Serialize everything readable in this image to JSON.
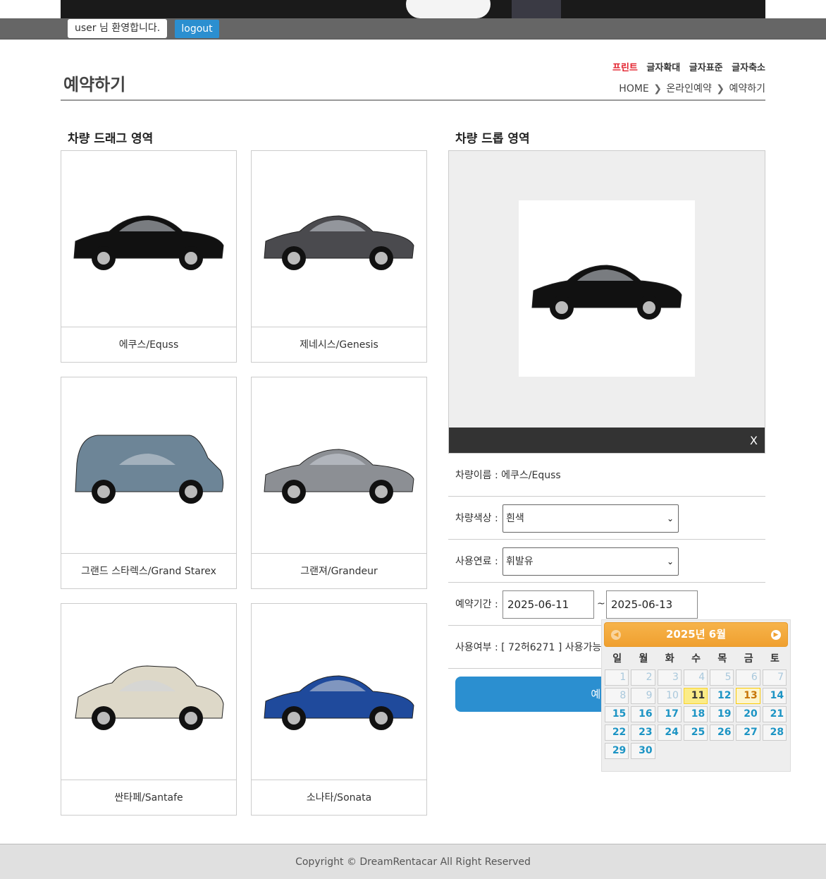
{
  "header": {
    "welcome": "user 님 환영합니다.",
    "logout": "logout"
  },
  "page": {
    "title": "예약하기",
    "utils": [
      "프린트",
      "글자확대",
      "글자표준",
      "글자축소"
    ],
    "breadcrumb": [
      "HOME",
      "온라인예약",
      "예약하기"
    ]
  },
  "drag": {
    "title": "차량 드래그 영역",
    "cars": [
      {
        "name": "에쿠스/Equss",
        "color": "#111111"
      },
      {
        "name": "제네시스/Genesis",
        "color": "#4a4a4e"
      },
      {
        "name": "그랜드 스타렉스/Grand Starex",
        "color": "#6d8597"
      },
      {
        "name": "그랜져/Grandeur",
        "color": "#8c8f94"
      },
      {
        "name": "싼타페/Santafe",
        "color": "#ddd8c8"
      },
      {
        "name": "소나타/Sonata",
        "color": "#1f4a9c"
      }
    ]
  },
  "drop": {
    "title": "차량 드롭 영역",
    "close": "X",
    "car_name_label": "차량이름 : 에쿠스/Equss",
    "color_label": "차량색상 :",
    "color_value": "흰색",
    "fuel_label": "사용연료 :",
    "fuel_value": "휘발유",
    "period_label": "예약기간 :",
    "start_date": "2025-06-11",
    "tilde": "~",
    "end_date": "2025-06-13",
    "usage_label": "사용여부 : [ 72허6271 ] 사용가능",
    "submit": "예약하기"
  },
  "datepicker": {
    "title": "2025년 6월",
    "weekdays": [
      "일",
      "월",
      "화",
      "수",
      "목",
      "금",
      "토"
    ],
    "past_days": [
      1,
      2,
      3,
      4,
      5,
      6,
      7,
      8,
      9,
      10
    ],
    "today": 11,
    "selected": 13,
    "last_day": 30
  },
  "footer": "Copyright © DreamRentacar All Right Reserved"
}
